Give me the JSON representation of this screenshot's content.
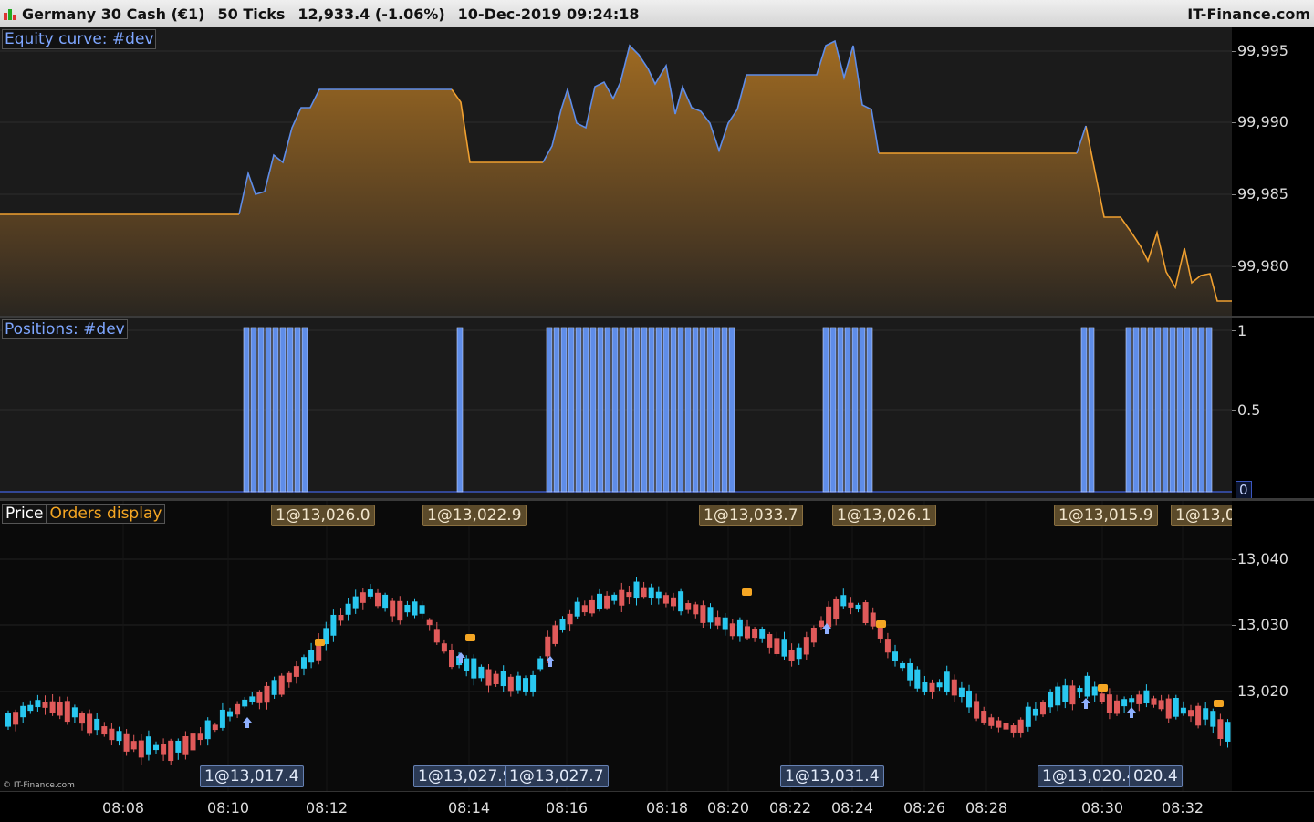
{
  "header": {
    "instrument": "Germany 30 Cash (€1)",
    "period": "50 Ticks",
    "quote": "12,933.4 (-1.06%)",
    "datetime": "10-Dec-2019 09:24:18",
    "brand": "IT-Finance.com"
  },
  "equity_panel": {
    "label": "Equity curve: #dev",
    "axis_ticks": [
      "99,995",
      "99,990",
      "99,985",
      "99,980"
    ],
    "colors": {
      "line": "#5f8de8",
      "fill_top": "#9a6a24",
      "fill_bottom": "#2a2a2a"
    }
  },
  "positions_panel": {
    "label": "Positions: #dev",
    "axis_ticks": [
      "1",
      "0.5",
      "0"
    ],
    "colors": {
      "bar": "#5f8de8"
    }
  },
  "price_panel": {
    "label": "Price",
    "overlay_label": "Orders display",
    "axis_ticks": [
      "13,040",
      "13,030",
      "13,020"
    ],
    "sell_tags": [
      "1@13,026.0",
      "1@13,022.9",
      "1@13,033.7",
      "1@13,026.1",
      "1@13,015.9",
      "1@13,0"
    ],
    "buy_tags": [
      "1@13,017.4",
      "1@13,027.9",
      "1@13,027.7",
      "1@13,031.4",
      "1@13,020.4",
      "020.4"
    ],
    "colors": {
      "up": "#29c8f0",
      "down": "#e05a5a",
      "marker": "#f5a623",
      "arrow": "#8fb0ff"
    }
  },
  "time_axis": [
    "08:08",
    "08:10",
    "08:12",
    "08:14",
    "08:16",
    "08:18",
    "08:20",
    "08:22",
    "08:24",
    "08:26",
    "08:28",
    "08:30",
    "08:32"
  ],
  "copyright": "© IT-Finance.com"
}
